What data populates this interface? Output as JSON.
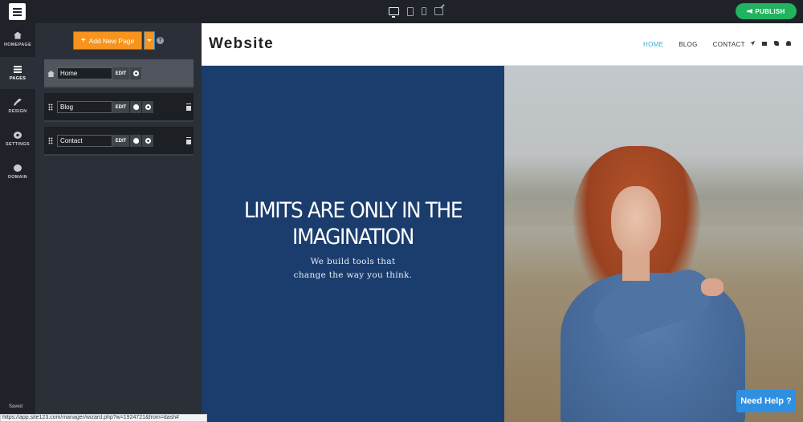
{
  "topbar": {
    "publish_label": "PUBLISH",
    "devices": [
      "desktop-icon",
      "tablet-icon",
      "phone-icon",
      "external-link-icon"
    ],
    "publish_color": "#21b35f"
  },
  "rail": {
    "items": [
      {
        "label": "HOMEPAGE",
        "icon": "home-icon"
      },
      {
        "label": "PAGES",
        "icon": "pages-icon"
      },
      {
        "label": "DESIGN",
        "icon": "brush-icon"
      },
      {
        "label": "SETTINGS",
        "icon": "gear-icon"
      },
      {
        "label": "DOMAIN",
        "icon": "globe-icon"
      }
    ],
    "saved_label": "Saved"
  },
  "panel": {
    "add_page_label": "Add New Page",
    "accent_color": "#f7941d",
    "pages": [
      {
        "name": "Home",
        "edit_label": "EDIT"
      },
      {
        "name": "Blog",
        "edit_label": "EDIT"
      },
      {
        "name": "Contact",
        "edit_label": "EDIT"
      }
    ]
  },
  "statusbar": {
    "url": "https://app.site123.com/manager/wizard.php?w=1924721&from=dash#"
  },
  "site": {
    "brand": "Website",
    "nav": {
      "links": [
        "HOME",
        "BLOG",
        "CONTACT"
      ],
      "active": "HOME",
      "icons": [
        "location-arrow-icon",
        "envelope-icon",
        "phone-icon",
        "user-icon"
      ]
    },
    "hero": {
      "title_line1": "LIMITS ARE ONLY IN THE",
      "title_line2": "IMAGINATION",
      "subtitle_line1": "We build tools that",
      "subtitle_line2": "change the way you think.",
      "left_color": "#1b3d6d"
    }
  },
  "help": {
    "label": "Need Help ?"
  }
}
